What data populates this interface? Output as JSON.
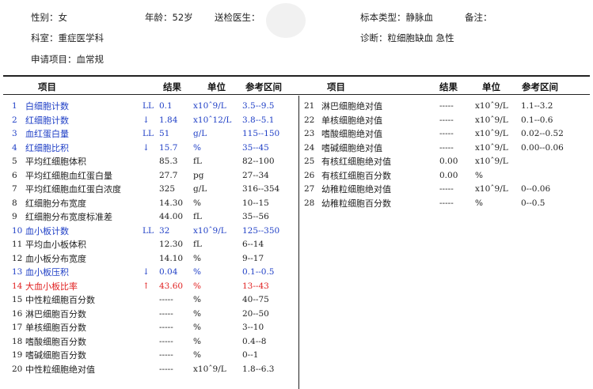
{
  "header": {
    "gender": "性别：女",
    "age": "年龄：52岁",
    "doctor": "送检医生：",
    "sample_type": "标本类型：静脉血",
    "remark": "备注：",
    "department": "科室：重症医学科",
    "diagnosis": "诊断：粒细胞缺血 急性",
    "request": "申请项目：血常规"
  },
  "columns": {
    "item": "项目",
    "result": "结果",
    "unit": "单位",
    "range": "参考区间"
  },
  "colors": {
    "abnormal_low": "#1f3fc6",
    "abnormal_high": "#e02020",
    "normal": "#222222"
  },
  "left_rows": [
    {
      "no": "1",
      "name": "白细胞计数",
      "flag": "LL",
      "result": "0.1",
      "unit": "x10ˆ9/L",
      "range": "3.5--9.5",
      "status": "low"
    },
    {
      "no": "2",
      "name": "红细胞计数",
      "flag": "↓",
      "result": "1.84",
      "unit": "x10ˆ12/L",
      "range": "3.8--5.1",
      "status": "low"
    },
    {
      "no": "3",
      "name": "血红蛋白量",
      "flag": "LL",
      "result": "51",
      "unit": "g/L",
      "range": "115--150",
      "status": "low"
    },
    {
      "no": "4",
      "name": "红细胞比积",
      "flag": "↓",
      "result": "15.7",
      "unit": "%",
      "range": "35--45",
      "status": "low"
    },
    {
      "no": "5",
      "name": "平均红细胞体积",
      "flag": "",
      "result": "85.3",
      "unit": "fL",
      "range": "82--100",
      "status": "normal"
    },
    {
      "no": "6",
      "name": "平均红细胞血红蛋白量",
      "flag": "",
      "result": "27.7",
      "unit": "pg",
      "range": "27--34",
      "status": "normal"
    },
    {
      "no": "7",
      "name": "平均红细胞血红蛋白浓度",
      "flag": "",
      "result": "325",
      "unit": "g/L",
      "range": "316--354",
      "status": "normal"
    },
    {
      "no": "8",
      "name": "红细胞分布宽度",
      "flag": "",
      "result": "14.30",
      "unit": "%",
      "range": "10--15",
      "status": "normal"
    },
    {
      "no": "9",
      "name": "红细胞分布宽度标准差",
      "flag": "",
      "result": "44.00",
      "unit": "fL",
      "range": "35--56",
      "status": "normal"
    },
    {
      "no": "10",
      "name": "血小板计数",
      "flag": "LL",
      "result": "32",
      "unit": "x10ˆ9/L",
      "range": "125--350",
      "status": "low"
    },
    {
      "no": "11",
      "name": "平均血小板体积",
      "flag": "",
      "result": "12.30",
      "unit": "fL",
      "range": "6--14",
      "status": "normal"
    },
    {
      "no": "12",
      "name": "血小板分布宽度",
      "flag": "",
      "result": "14.10",
      "unit": "%",
      "range": "9--17",
      "status": "normal"
    },
    {
      "no": "13",
      "name": "血小板压积",
      "flag": "↓",
      "result": "0.04",
      "unit": "%",
      "range": "0.1--0.5",
      "status": "low"
    },
    {
      "no": "14",
      "name": "大血小板比率",
      "flag": "↑",
      "result": "43.60",
      "unit": "%",
      "range": "13--43",
      "status": "high"
    },
    {
      "no": "15",
      "name": "中性粒细胞百分数",
      "flag": "",
      "result": "-----",
      "unit": "%",
      "range": "40--75",
      "status": "normal"
    },
    {
      "no": "16",
      "name": "淋巴细胞百分数",
      "flag": "",
      "result": "-----",
      "unit": "%",
      "range": "20--50",
      "status": "normal"
    },
    {
      "no": "17",
      "name": "单核细胞百分数",
      "flag": "",
      "result": "-----",
      "unit": "%",
      "range": "3--10",
      "status": "normal"
    },
    {
      "no": "18",
      "name": "嗜酸细胞百分数",
      "flag": "",
      "result": "-----",
      "unit": "%",
      "range": "0.4--8",
      "status": "normal"
    },
    {
      "no": "19",
      "name": "嗜碱细胞百分数",
      "flag": "",
      "result": "-----",
      "unit": "%",
      "range": "0--1",
      "status": "normal"
    },
    {
      "no": "20",
      "name": "中性粒细胞绝对值",
      "flag": "",
      "result": "-----",
      "unit": "x10ˆ9/L",
      "range": "1.8--6.3",
      "status": "normal"
    }
  ],
  "right_rows": [
    {
      "no": "21",
      "name": "淋巴细胞绝对值",
      "result": "-----",
      "unit": "x10ˆ9/L",
      "range": "1.1--3.2"
    },
    {
      "no": "22",
      "name": "单核细胞绝对值",
      "result": "-----",
      "unit": "x10ˆ9/L",
      "range": "0.1--0.6"
    },
    {
      "no": "23",
      "name": "嗜酸细胞绝对值",
      "result": "-----",
      "unit": "x10ˆ9/L",
      "range": "0.02--0.52"
    },
    {
      "no": "24",
      "name": "嗜碱细胞绝对值",
      "result": "-----",
      "unit": "x10ˆ9/L",
      "range": "0.00--0.06"
    },
    {
      "no": "25",
      "name": "有核红细胞绝对值",
      "result": "0.00",
      "unit": "x10ˆ9/L",
      "range": ""
    },
    {
      "no": "26",
      "name": "有核红细胞百分数",
      "result": "0.00",
      "unit": "%",
      "range": ""
    },
    {
      "no": "27",
      "name": "幼稚粒细胞绝对值",
      "result": "-----",
      "unit": "x10ˆ9/L",
      "range": "0--0.06"
    },
    {
      "no": "28",
      "name": "幼稚粒细胞百分数",
      "result": "-----",
      "unit": "%",
      "range": "0--0.5"
    }
  ]
}
